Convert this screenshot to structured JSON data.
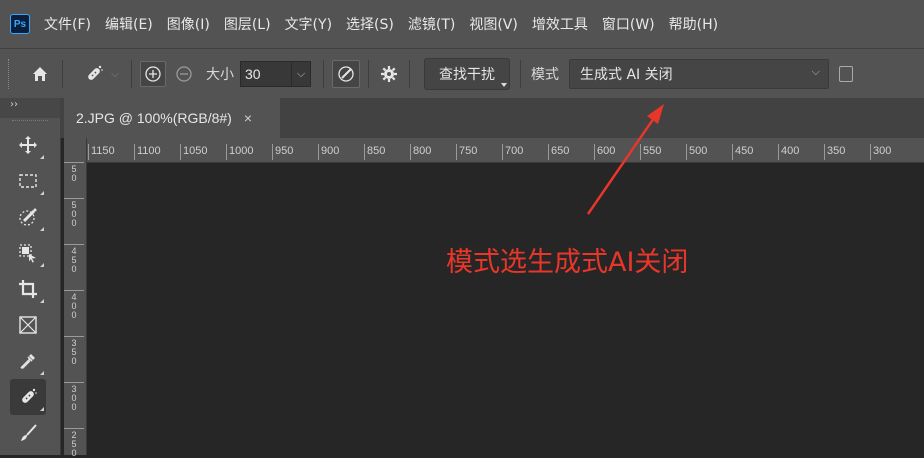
{
  "app": {
    "logo": "Ps"
  },
  "menu": [
    "文件(F)",
    "编辑(E)",
    "图像(I)",
    "图层(L)",
    "文字(Y)",
    "选择(S)",
    "滤镜(T)",
    "视图(V)",
    "增效工具",
    "窗口(W)",
    "帮助(H)"
  ],
  "options": {
    "size_label": "大小",
    "size_value": "30",
    "find_button": "查找干扰",
    "mode_label": "模式",
    "mode_value": "生成式 AI 关闭"
  },
  "document": {
    "tab_title": "2.JPG @ 100%(RGB/8#)",
    "close": "×"
  },
  "toolbar_panel": {
    "collapse": "››"
  },
  "ruler": {
    "horizontal": [
      "1150",
      "1100",
      "1050",
      "1000",
      "950",
      "900",
      "850",
      "800",
      "750",
      "700",
      "650",
      "600",
      "550",
      "500",
      "450",
      "400",
      "350",
      "300"
    ],
    "vertical": [
      "50",
      "500",
      "450",
      "400",
      "350",
      "300",
      "250"
    ]
  },
  "annotation": {
    "text": "模式选生成式AI关闭",
    "color": "#e8362a"
  },
  "colors": {
    "ui_gray": "#535353",
    "canvas": "#262626",
    "accent": "#31a8ff"
  },
  "icons": [
    "home-icon",
    "spot-healing-icon",
    "add-mode-icon",
    "subtract-mode-icon",
    "pressure-icon",
    "gear-icon",
    "move-icon",
    "marquee-icon",
    "quick-select-icon",
    "object-select-icon",
    "crop-icon",
    "frame-icon",
    "eyedropper-icon",
    "healing-brush-icon",
    "brush-icon"
  ]
}
